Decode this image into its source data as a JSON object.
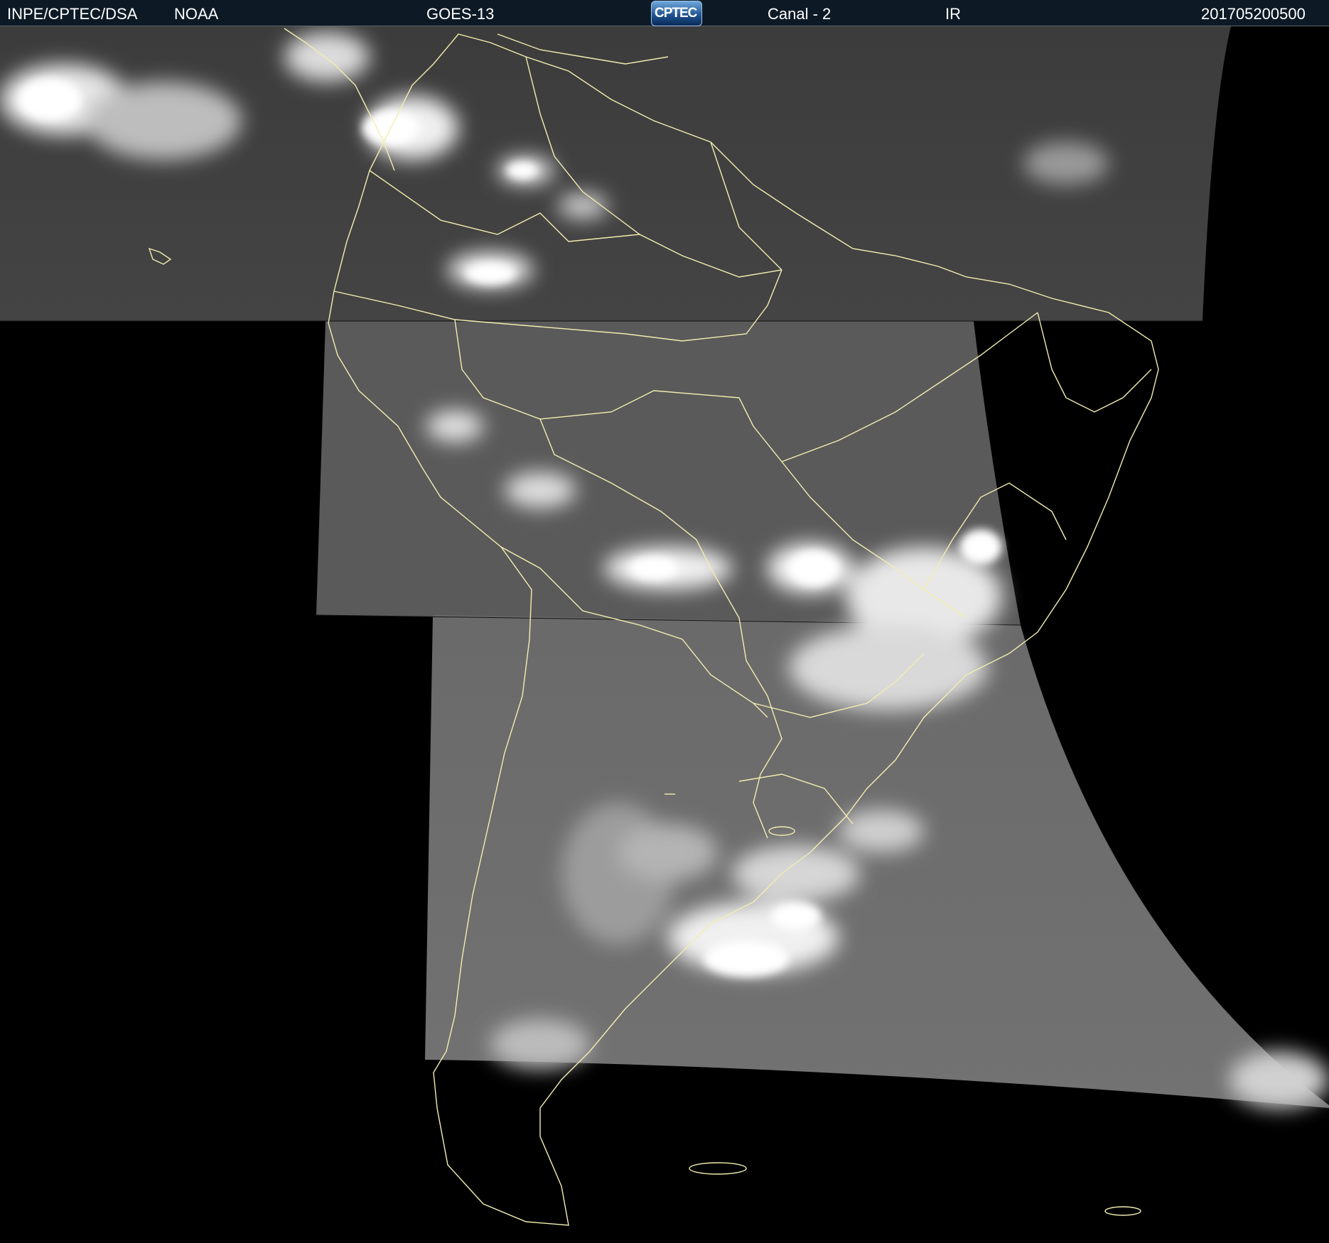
{
  "header": {
    "agency": "INPE/CPTEC/DSA",
    "partner": "NOAA",
    "satellite": "GOES-13",
    "logo_text": "CPTEC",
    "channel": "Canal - 2",
    "band": "IR",
    "timestamp": "201705200500"
  },
  "colors": {
    "background": "#000000",
    "header_bg": "#0d1a26",
    "coastline": "#f2eeb0",
    "cloud_bright": "#ffffff",
    "ocean_gray": "#6e6e6e"
  }
}
